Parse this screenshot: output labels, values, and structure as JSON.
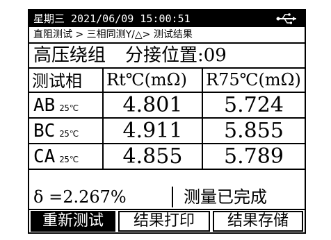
{
  "status": {
    "datetime": "星期三 2021/06/09 15:00:51",
    "icon": "usb-icon"
  },
  "breadcrumb": "直阻测试 > 三相同测Y/△> 测试结果",
  "header": {
    "title": "高压绕组",
    "tap_position": "分接位置:09"
  },
  "table": {
    "headers": [
      "测试相",
      "Rt℃(mΩ)",
      "R75℃(mΩ)"
    ],
    "rows": [
      {
        "phase": "AB",
        "temp": "25℃",
        "rt": "4.801",
        "r75": "5.724"
      },
      {
        "phase": "BC",
        "temp": "25℃",
        "rt": "4.911",
        "r75": "5.855"
      },
      {
        "phase": "CA",
        "temp": "25℃",
        "rt": "4.855",
        "r75": "5.789"
      }
    ]
  },
  "summary": {
    "delta": "δ =2.267%",
    "state": "测量已完成"
  },
  "buttons": {
    "retest": "重新测试",
    "print": "结果打印",
    "save": "结果存储"
  },
  "colors": {
    "background": "#ffffff",
    "foreground": "#000000"
  }
}
